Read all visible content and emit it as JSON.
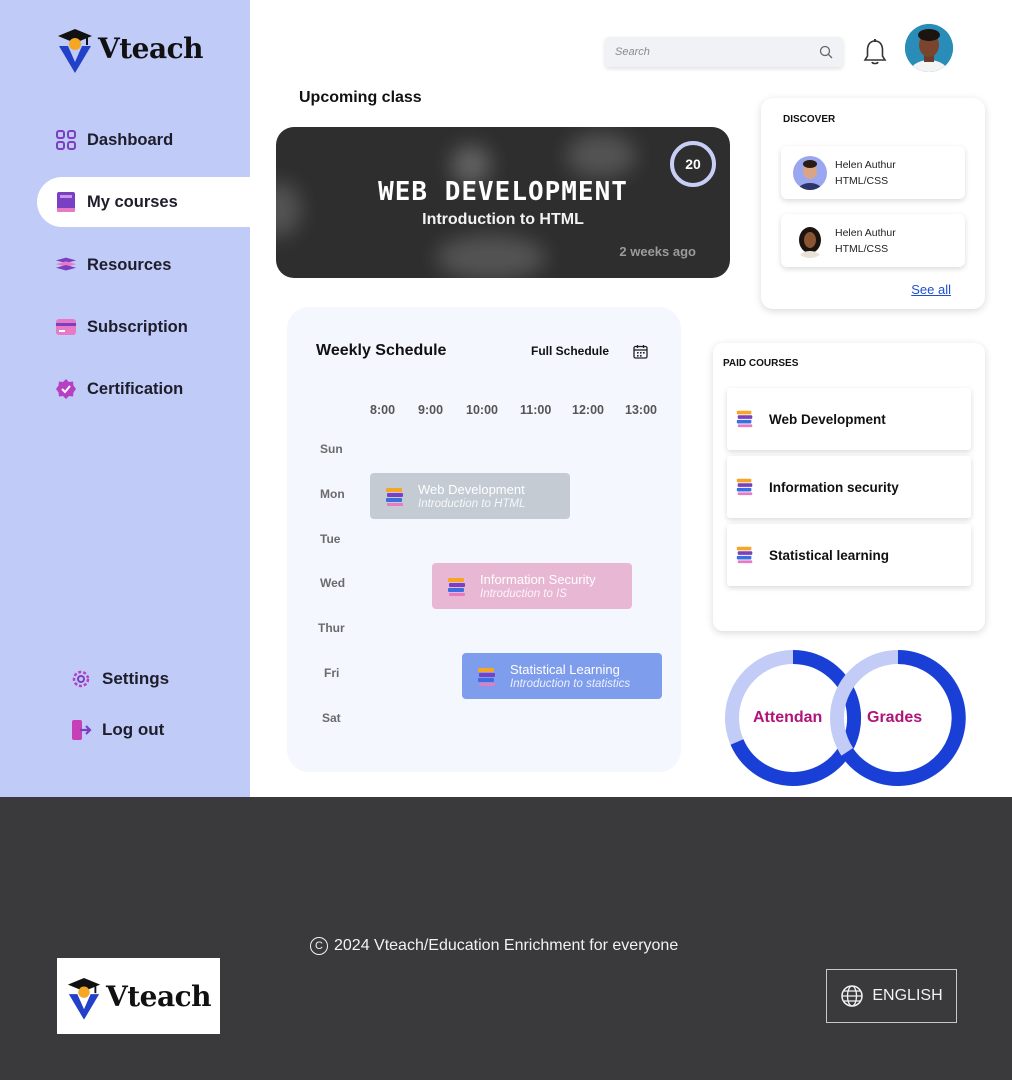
{
  "brand": {
    "name": "Vteach"
  },
  "sidebar": {
    "items": [
      {
        "label": "Dashboard",
        "icon": "grid-icon"
      },
      {
        "label": "My courses",
        "icon": "book-icon",
        "active": true
      },
      {
        "label": "Resources",
        "icon": "books-stack-icon"
      },
      {
        "label": "Subscription",
        "icon": "card-icon"
      },
      {
        "label": "Certification",
        "icon": "badge-check-icon"
      }
    ],
    "bottom": [
      {
        "label": "Settings",
        "icon": "gear-icon"
      },
      {
        "label": "Log out",
        "icon": "logout-icon"
      }
    ]
  },
  "header": {
    "search_placeholder": "Search"
  },
  "upcoming": {
    "title": "Upcoming class",
    "course": "WEB DEVELOPMENT",
    "topic": "Introduction to HTML",
    "time_ago": "2 weeks ago",
    "count": "20"
  },
  "discover": {
    "title": "DISCOVER",
    "tutors": [
      {
        "name": "Helen Authur",
        "course": "HTML/CSS"
      },
      {
        "name": "Helen Authur",
        "course": "HTML/CSS"
      }
    ],
    "see_all": "See all"
  },
  "schedule": {
    "title": "Weekly Schedule",
    "full_label": "Full Schedule",
    "times": [
      "8:00",
      "9:00",
      "10:00",
      "11:00",
      "12:00",
      "13:00"
    ],
    "days": [
      "Sun",
      "Mon",
      "Tue",
      "Wed",
      "Thur",
      "Fri",
      "Sat"
    ],
    "events": [
      {
        "title": "Web Development",
        "subtitle": "Introduction to HTML",
        "color": "#c5cbd3"
      },
      {
        "title": "Information Security",
        "subtitle": "Introduction to IS",
        "color": "#e8b7d4"
      },
      {
        "title": "Statistical Learning",
        "subtitle": "Introduction to statistics",
        "color": "#7f9ded"
      }
    ]
  },
  "paid_courses": {
    "title": "PAID COURSES",
    "items": [
      "Web Development",
      "Information security",
      "Statistical learning"
    ]
  },
  "metrics": {
    "attendance": "Attendan",
    "grades": "Grades"
  },
  "footer": {
    "copyright": "2024 Vteach/Education Enrichment for everyone",
    "language": "ENGLISH"
  },
  "colors": {
    "sidebar_bg": "#c0cbf7",
    "ring_dark": "#1a3fd6",
    "ring_light": "#c3ccf7",
    "metric_label": "#b0147a",
    "footer_bg": "#3a393b"
  }
}
